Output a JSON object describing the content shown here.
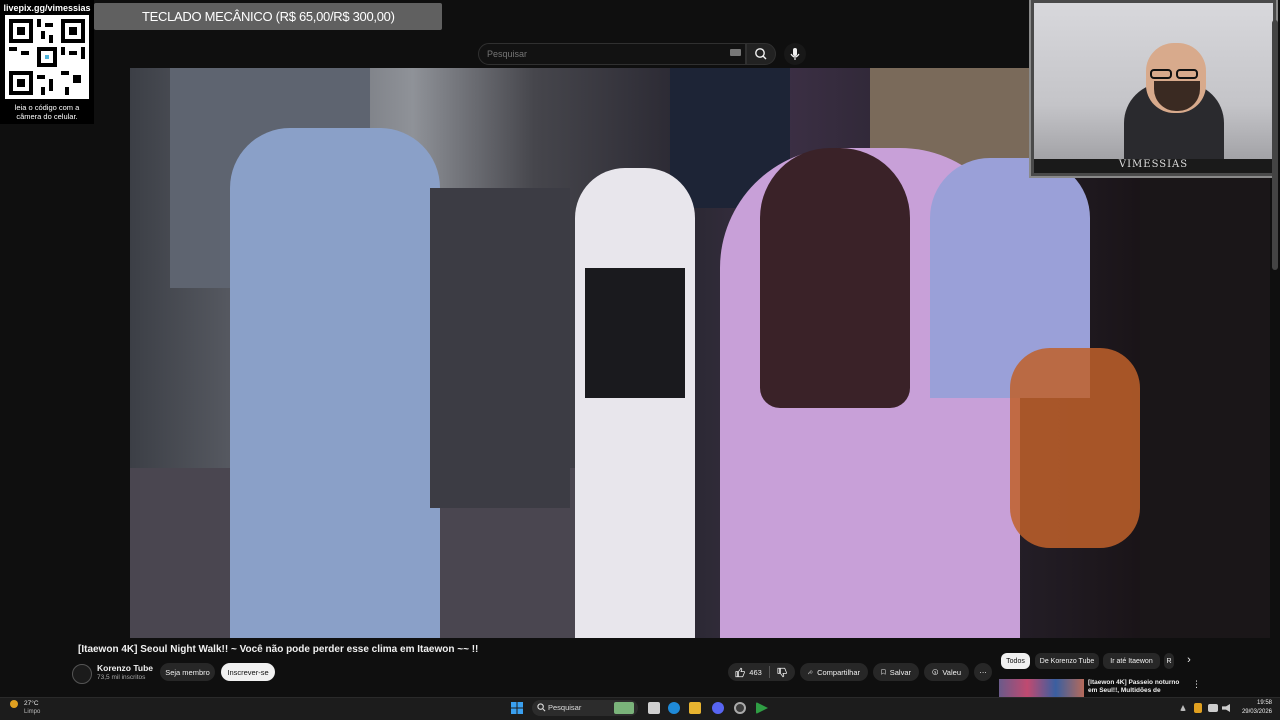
{
  "overlay": {
    "qr_url": "livepix.gg/vimessias",
    "qr_caption": "leia o código com a câmera do celular.",
    "promo_text": "TECLADO MECÂNICO (R$ 65,00/R$ 300,00)",
    "webcam_name": "VIMESSIAS"
  },
  "header": {
    "search_placeholder": "Pesquisar",
    "search_icon": "search-icon",
    "mic_icon": "mic-icon",
    "keyboard_icon": "keyboard-icon"
  },
  "video": {
    "title": "[Itaewon 4K]  Seoul Night Walk!! ~ Você não pode perder esse clima em Itaewon ~~ !!",
    "channel_name": "Korenzo Tube",
    "subscribers": "73,5 mil inscritos",
    "join_label": "Seja membro",
    "subscribe_label": "Inscrever-se",
    "like_count": "463",
    "share_label": "Compartilhar",
    "save_label": "Salvar",
    "thanks_label": "Valeu",
    "more_label": "⋯"
  },
  "recommendations": {
    "chips": [
      "Todos",
      "De Korenzo Tube",
      "Ir até Itaewon",
      "R"
    ],
    "next_arrow": "›",
    "first_title": "[Itaewon 4K] Passeio noturno em Seul!!, Multidões de",
    "menu": "⋮"
  },
  "taskbar": {
    "weather_temp": "27°C",
    "weather_desc": "Limpo",
    "search_label": "Pesquisar",
    "time": "19:58",
    "date": "29/03/2026"
  },
  "colors": {
    "background": "#0f0f0f",
    "pill": "#272727",
    "subscribe_bg": "#f1f1f1",
    "text": "#f1f1f1"
  }
}
